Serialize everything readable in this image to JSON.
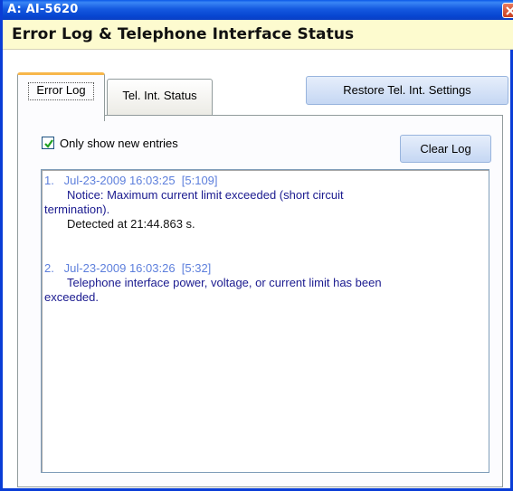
{
  "window": {
    "title": "A: AI-5620",
    "close_icon": "close-icon"
  },
  "header": {
    "title": "Error Log & Telephone Interface Status"
  },
  "tabs": [
    {
      "label": "Error Log",
      "active": true
    },
    {
      "label": "Tel. Int. Status",
      "active": false
    }
  ],
  "buttons": {
    "restore_label": "Restore Tel. Int. Settings",
    "clear_label": "Clear Log"
  },
  "filter": {
    "checkbox_label": "Only show new entries",
    "checked": true
  },
  "log": {
    "entries": [
      {
        "header": "1.   Jul-23-2009 16:03:25  [5:109]",
        "message_line1": "Notice:  Maximum current limit exceeded (short circuit",
        "message_line2": "termination).",
        "detail": "Detected at 21:44.863 s."
      },
      {
        "header": "2.   Jul-23-2009 16:03:26  [5:32]",
        "message_line1": "Telephone interface power, voltage, or current limit has been",
        "message_line2": "exceeded."
      }
    ]
  },
  "colors": {
    "titlebar": "#0a58e8",
    "header_bg": "#fdfbcf",
    "entry_header": "#5d7fdc",
    "entry_message": "#1a1a8f",
    "active_tab_accent": "#f7b64a"
  }
}
